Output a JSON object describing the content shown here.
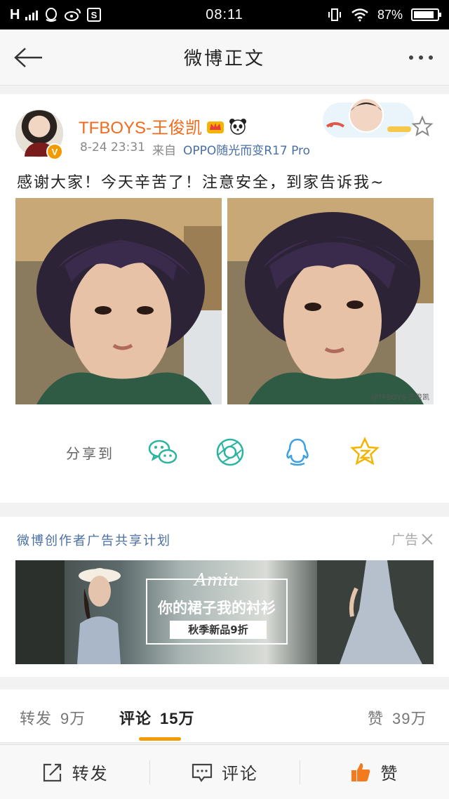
{
  "status_bar": {
    "carrier": "H",
    "time": "08:11",
    "battery": "87%",
    "battery_level": 0.87,
    "icons": [
      "signal-icon",
      "qq-icon",
      "weibo-icon",
      "s-icon",
      "vibrate-icon",
      "wifi-icon",
      "battery-icon"
    ]
  },
  "nav": {
    "title": "微博正文",
    "back_icon": "arrow-left-icon",
    "more_icon": "more-dots-icon"
  },
  "post": {
    "username": "TFBOYS-王俊凯",
    "date": "8-24 23:31",
    "source_prefix": "来自",
    "source": "OPPO随光而变R17 Pro",
    "content": "感谢大家！今天辛苦了！注意安全，到家告诉我~",
    "verified_badge": "V",
    "photo_watermark": "@TFBOYS-王俊凯",
    "colors": {
      "username": "#f26a1b",
      "link": "#4a6fa5",
      "accent": "#f39a00"
    }
  },
  "share": {
    "label": "分享到",
    "targets": [
      "wechat-icon",
      "moments-icon",
      "qq-icon",
      "qzone-icon"
    ]
  },
  "ad": {
    "title": "微博创作者广告共享计划",
    "tag": "广告",
    "script_text": "Amiu",
    "headline": "你的裙子我的衬衫",
    "subline": "秋季新品9折"
  },
  "stats": {
    "repost_label": "转发",
    "repost_count": "9万",
    "comment_label": "评论",
    "comment_count": "15万",
    "like_label": "赞",
    "like_count": "39万"
  },
  "toolbar": {
    "repost": "转发",
    "comment": "评论",
    "like": "赞"
  }
}
